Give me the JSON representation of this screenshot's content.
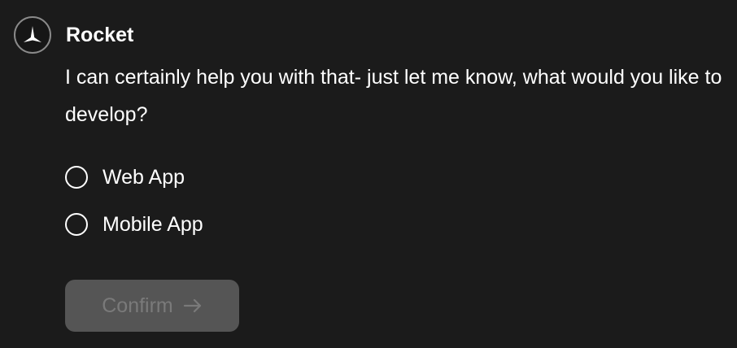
{
  "message": {
    "sender": {
      "name": "Rocket",
      "avatar_icon": "rocket-logo-icon"
    },
    "text": "I can certainly help you with that- just let me know, what would you like to develop?",
    "options": [
      {
        "label": "Web App",
        "selected": false
      },
      {
        "label": "Mobile App",
        "selected": false
      }
    ],
    "confirm_button": {
      "label": "Confirm",
      "icon": "arrow-right-icon",
      "disabled": true
    }
  },
  "colors": {
    "background": "#1b1b1b",
    "text": "#ffffff",
    "button_disabled_bg": "#555555",
    "button_disabled_text": "#7a7a7a"
  }
}
